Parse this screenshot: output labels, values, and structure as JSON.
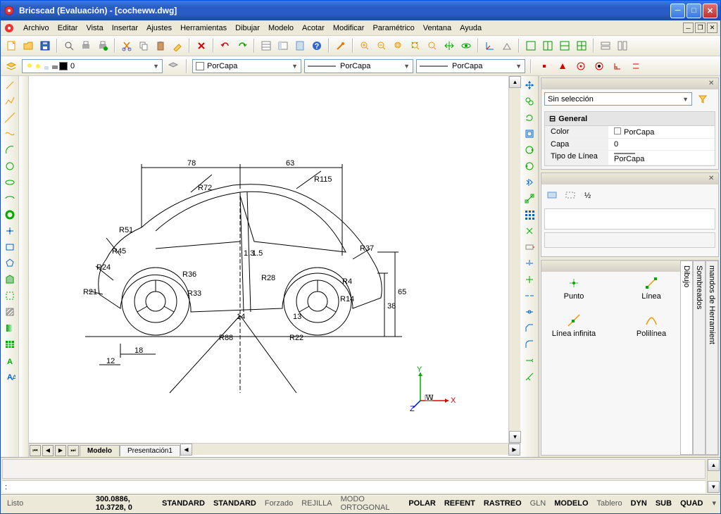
{
  "window": {
    "title": "Bricscad (Evaluación) - [cocheww.dwg]"
  },
  "menu": [
    "Archivo",
    "Editar",
    "Vista",
    "Insertar",
    "Ajustes",
    "Herramientas",
    "Dibujar",
    "Modelo",
    "Acotar",
    "Modificar",
    "Paramétrico",
    "Ventana",
    "Ayuda"
  ],
  "layer": {
    "current": "0"
  },
  "linetype": {
    "bylayer": "PorCapa"
  },
  "tabs": {
    "model": "Modelo",
    "layout1": "Presentación1"
  },
  "properties": {
    "noSelection": "Sin selección",
    "groupGeneral": "General",
    "rows": [
      {
        "k": "Color",
        "v": "PorCapa"
      },
      {
        "k": "Capa",
        "v": "0"
      },
      {
        "k": "Tipo de Línea",
        "v": "PorCapa"
      }
    ]
  },
  "toolpalette": {
    "items": [
      {
        "label": "Punto"
      },
      {
        "label": "Línea"
      },
      {
        "label": "Línea infinita"
      },
      {
        "label": "Polilínea"
      }
    ],
    "tabs": [
      "mandos de Herramient",
      "Sombreados",
      "Dibujo"
    ]
  },
  "drawing": {
    "dims": [
      "78",
      "63",
      "65",
      "38",
      "12",
      "18",
      "1.3",
      "1.5",
      "14",
      "13"
    ],
    "radii": [
      "R72",
      "R115",
      "R51",
      "R45",
      "R24",
      "R21",
      "R36",
      "R33",
      "R28",
      "R37",
      "R22",
      "R14",
      "R4",
      "R88"
    ]
  },
  "status": {
    "ready": "Listo",
    "coords": "300.0886, 10.3728, 0",
    "std1": "STANDARD",
    "std2": "STANDARD",
    "items": [
      {
        "t": "Forzado",
        "on": false
      },
      {
        "t": "REJILLA",
        "on": false
      },
      {
        "t": "MODO ORTOGONAL",
        "on": false
      },
      {
        "t": "POLAR",
        "on": true
      },
      {
        "t": "REFENT",
        "on": true
      },
      {
        "t": "RASTREO",
        "on": true
      },
      {
        "t": "GLN",
        "on": false
      },
      {
        "t": "MODELO",
        "on": true
      },
      {
        "t": "Tablero",
        "on": false
      },
      {
        "t": "DYN",
        "on": true
      },
      {
        "t": "SUB",
        "on": true
      },
      {
        "t": "QUAD",
        "on": true
      }
    ]
  },
  "cmd": {
    "prompt": ":"
  }
}
